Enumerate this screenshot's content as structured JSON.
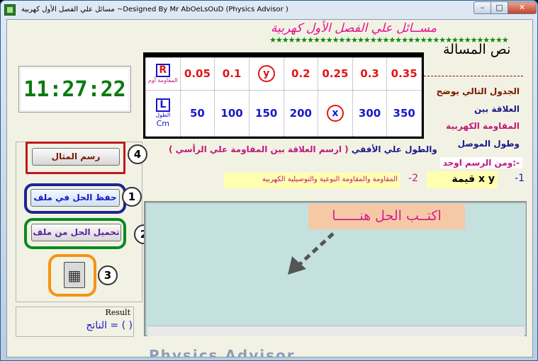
{
  "window": {
    "title": "مسائل علي الفصل الأول كهربية ~Designed By Mr AbOeLsOuD (Physics Advisor )",
    "min": "–",
    "max": "□",
    "close": "✕"
  },
  "header": {
    "heading": "مســائل علي الفصل الأول كهربية",
    "stars": "★★★★★★★★★★★★★★★★★★★★★★★★★★★★★★★★★★★★★★",
    "question_label": "نص المسالة"
  },
  "clock": "11:27:22",
  "table": {
    "r_head": {
      "letter": "R",
      "sub": "المقاومة أوم"
    },
    "l_head": {
      "letter": "L",
      "sub": "الطول",
      "unit": "Cm"
    },
    "r_values": [
      "0.05",
      "0.1",
      "y",
      "0.2",
      "0.25",
      "0.3",
      "0.35"
    ],
    "l_values": [
      "50",
      "100",
      "150",
      "200",
      "x",
      "300",
      "350"
    ]
  },
  "description": {
    "line1": "الجدول التالي يوضح",
    "line2": "العلاقة بين",
    "line3": "المقاومة الكهربية",
    "line4": "وطول الموصل",
    "line5": "ومن الرسم اوجد:-"
  },
  "instruction": {
    "part1": "والطول علي الأفقي",
    "part2": "( ارسم العلاقة بين المقاومة علي الرأسي )"
  },
  "requirements": {
    "r1_num": "-1",
    "r1": "قيمة x  y",
    "r2_num": "-2",
    "r2": "المقاومة والمقاومة النوعية والتوصيلية الكهربية"
  },
  "buttons": {
    "draw": "رسم المثال",
    "save": "حفظ الحل في ملف",
    "load": "تحميل الحل من ملف",
    "calc_icon": "calculator-icon"
  },
  "markers": {
    "n1": "1",
    "n2": "2",
    "n3": "3",
    "n4": "4"
  },
  "result": {
    "label": "Result",
    "value": "الناتج  =   (          )"
  },
  "answer": {
    "hint": "اكتــب الحل هنــــــا"
  },
  "bottom_deco": "Physics Advisor",
  "colors": {
    "clock": "#0b7a12",
    "r_row": "#e01616",
    "l_row": "#1818c8",
    "heading": "#e2148a",
    "answer_bg": "#c4e1e0"
  }
}
